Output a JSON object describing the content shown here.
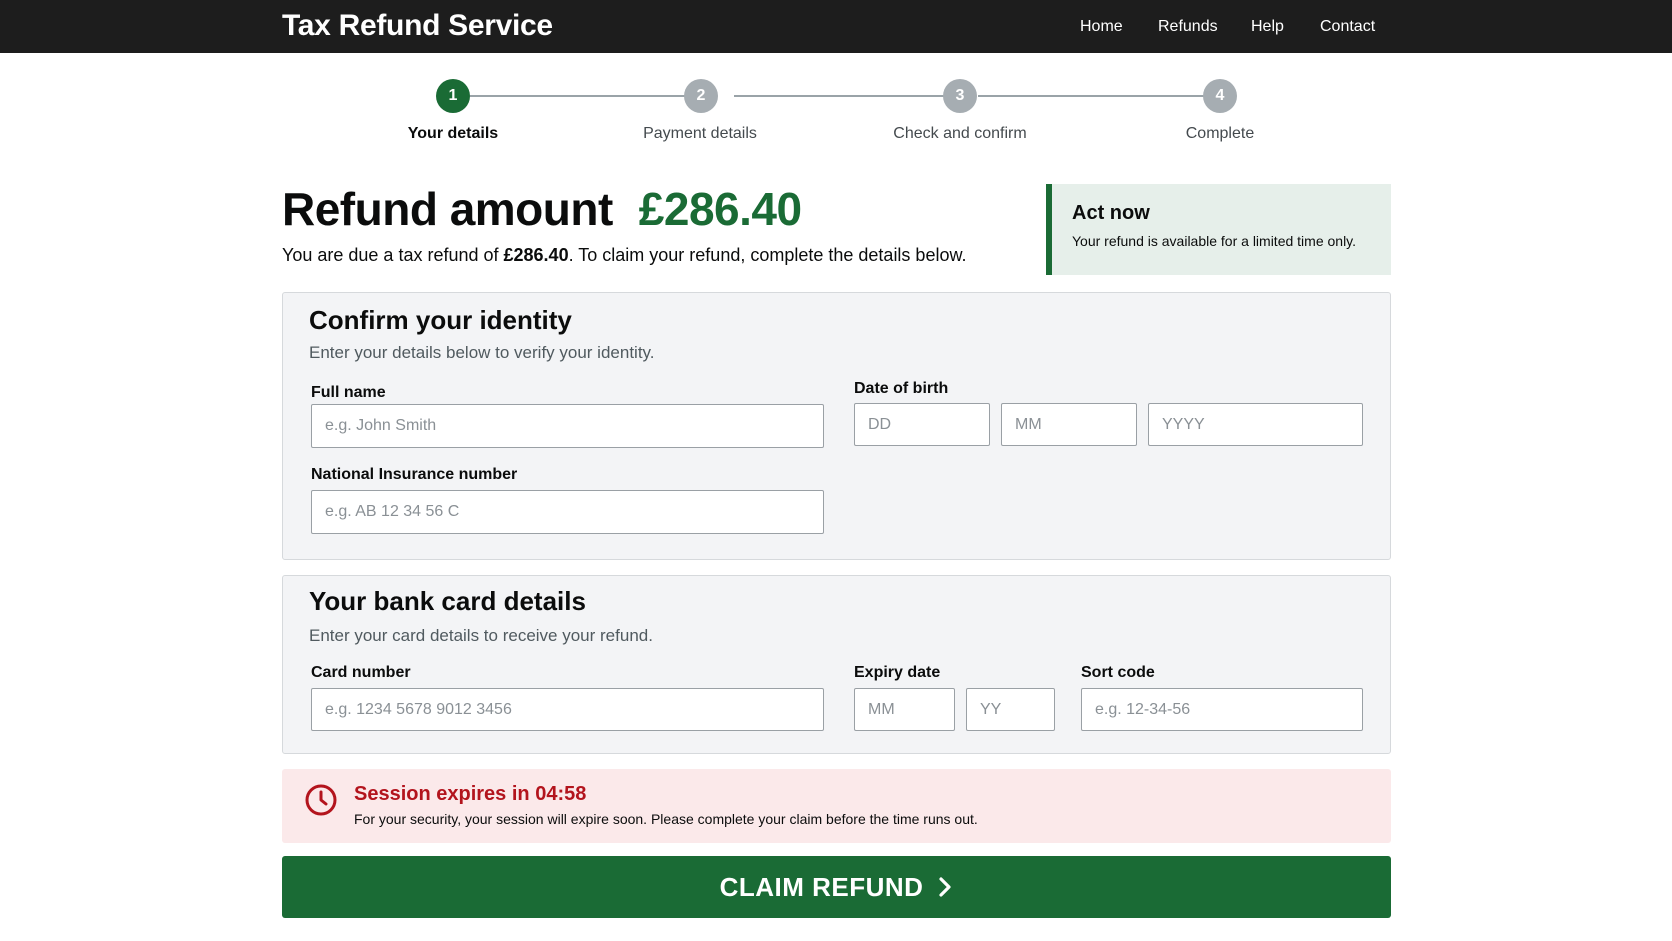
{
  "header": {
    "brand": "Tax Refund Service",
    "nav": [
      "Home",
      "Refunds",
      "Help",
      "Contact"
    ]
  },
  "steps": [
    {
      "number": "1",
      "label": "Your details",
      "active": true
    },
    {
      "number": "2",
      "label": "Payment details",
      "active": false
    },
    {
      "number": "3",
      "label": "Check and confirm",
      "active": false
    },
    {
      "number": "4",
      "label": "Complete",
      "active": false
    }
  ],
  "refund": {
    "title": "Refund amount",
    "amount": "£286.40",
    "sub_prefix": "You are due a tax refund of ",
    "sub_amount": "£286.40",
    "sub_suffix": ". To claim your refund, complete the details below."
  },
  "act_now": {
    "title": "Act now",
    "text": "Your refund is available for a limited time only."
  },
  "identity": {
    "title": "Confirm your identity",
    "subtitle": "Enter your details below to verify your identity.",
    "full_name_label": "Full name",
    "full_name_placeholder": "e.g. John Smith",
    "dob_label": "Date of birth",
    "dob_day_placeholder": "DD",
    "dob_month_placeholder": "MM",
    "dob_year_placeholder": "YYYY",
    "nin_label": "National Insurance number",
    "nin_placeholder": "e.g. AB 12 34 56 C"
  },
  "card": {
    "title": "Your bank card details",
    "subtitle": "Enter your card details to receive your refund.",
    "card_number_label": "Card number",
    "card_number_placeholder": "e.g. 1234 5678 9012 3456",
    "expiry_label": "Expiry date",
    "expiry_month_placeholder": "MM",
    "expiry_year_placeholder": "YY",
    "sort_code_label": "Sort code",
    "sort_code_placeholder": "e.g. 12-34-56"
  },
  "session": {
    "title": "Session expires in 04:58",
    "text": "For your security, your session will expire soon. Please complete your claim before the time runs out."
  },
  "claim_button": {
    "label": "CLAIM REFUND"
  },
  "colors": {
    "primary_green": "#1a6b35",
    "header_bg": "#1d1d1d",
    "warning_red": "#b3141d",
    "warning_bg": "#fbe9ea",
    "step_inactive": "#a6adb2"
  },
  "icons": {
    "session": "clock-icon",
    "claim": "chevron-right-icon"
  }
}
